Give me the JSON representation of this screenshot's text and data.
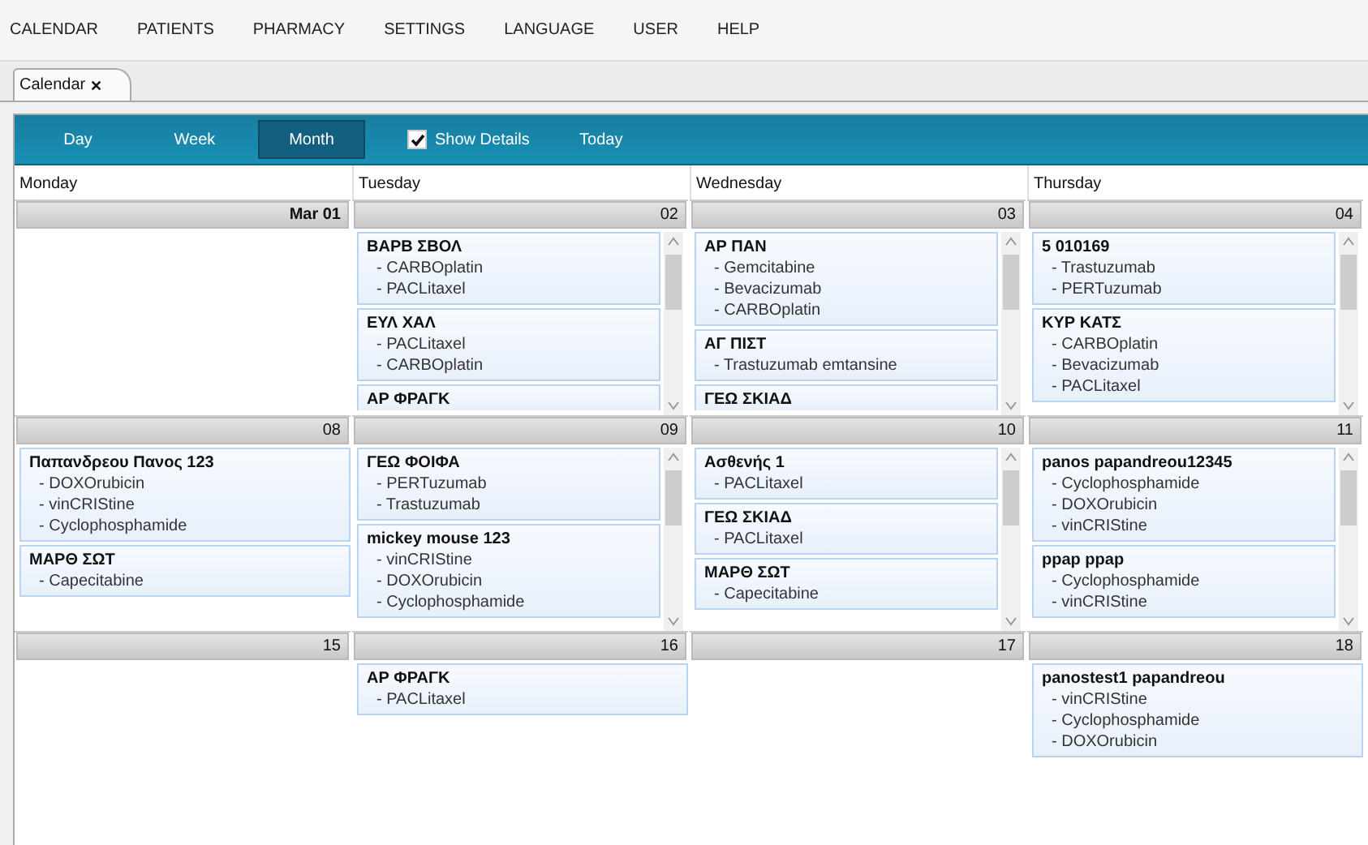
{
  "menu": [
    "CALENDAR",
    "PATIENTS",
    "PHARMACY",
    "SETTINGS",
    "LANGUAGE",
    "USER",
    "HELP"
  ],
  "tabs": [
    {
      "label": "Calendar",
      "close": "✕",
      "selected": true
    }
  ],
  "toolbar": {
    "views": [
      {
        "label": "Day",
        "selected": false
      },
      {
        "label": "Week",
        "selected": false
      },
      {
        "label": "Month",
        "selected": true
      }
    ],
    "show_details": {
      "label": "Show Details",
      "checked": true
    },
    "today": "Today"
  },
  "day_names": [
    "Monday",
    "Tuesday",
    "Wednesday",
    "Thursday"
  ],
  "weeks": [
    {
      "days": [
        {
          "date": "Mar 01"
        },
        {
          "date": "02",
          "appointments": [
            {
              "patient": "ΒΑΡΒ ΣΒΟΛ",
              "drugs": [
                "- CARBOplatin",
                "- PACLitaxel"
              ]
            },
            {
              "patient": "ΕΥΛ ΧΑΛ",
              "drugs": [
                "- PACLitaxel",
                "- CARBOplatin"
              ]
            },
            {
              "patient": "ΑΡ ΦΡΑΓΚ"
            }
          ]
        },
        {
          "date": "03",
          "appointments": [
            {
              "patient": "ΑΡ ΠΑΝ",
              "drugs": [
                "- Gemcitabine",
                "- Bevacizumab",
                "- CARBOplatin"
              ]
            },
            {
              "patient": "ΑΓ ΠΙΣΤ",
              "drugs": [
                "- Trastuzumab emtansine"
              ]
            },
            {
              "patient": "ΓΕΩ ΣΚΙΑΔ"
            }
          ]
        },
        {
          "date": "04",
          "appointments": [
            {
              "patient": "5 010169",
              "drugs": [
                "- Trastuzumab",
                "- PERTuzumab"
              ]
            },
            {
              "patient": "ΚΥΡ ΚΑΤΣ",
              "drugs": [
                "- CARBOplatin",
                "- Bevacizumab",
                "- PACLitaxel"
              ]
            }
          ]
        }
      ]
    },
    {
      "days": [
        {
          "date": "08",
          "appointments": [
            {
              "patient": "Παπανδρεου Πανος 123",
              "drugs": [
                "- DOXOrubicin",
                "- vinCRIStine",
                "- Cyclophosphamide"
              ]
            },
            {
              "patient": "ΜΑΡΘ ΣΩΤ",
              "drugs": [
                "- Capecitabine"
              ]
            }
          ]
        },
        {
          "date": "09",
          "appointments": [
            {
              "patient": "ΓΕΩ ΦΟΙΦΑ",
              "drugs": [
                "- PERTuzumab",
                "- Trastuzumab"
              ]
            },
            {
              "patient": "mickey mouse 123",
              "drugs": [
                "- vinCRIStine",
                "- DOXOrubicin",
                "- Cyclophosphamide"
              ]
            }
          ]
        },
        {
          "date": "10",
          "appointments": [
            {
              "patient": "Ασθενής  1",
              "drugs": [
                "- PACLitaxel"
              ]
            },
            {
              "patient": "ΓΕΩ ΣΚΙΑΔ",
              "drugs": [
                "- PACLitaxel"
              ]
            },
            {
              "patient": "ΜΑΡΘ ΣΩΤ",
              "drugs": [
                "- Capecitabine"
              ]
            }
          ]
        },
        {
          "date": "11",
          "appointments": [
            {
              "patient": "panos papandreou12345",
              "drugs": [
                "- Cyclophosphamide",
                "- DOXOrubicin",
                "- vinCRIStine"
              ]
            },
            {
              "patient": "ppap ppap",
              "drugs": [
                "- Cyclophosphamide",
                "- vinCRIStine"
              ]
            }
          ]
        }
      ]
    },
    {
      "days": [
        {
          "date": "15"
        },
        {
          "date": "16",
          "appointments": [
            {
              "patient": "ΑΡ ΦΡΑΓΚ",
              "drugs": [
                "- PACLitaxel"
              ]
            }
          ]
        },
        {
          "date": "17"
        },
        {
          "date": "18",
          "appointments": [
            {
              "patient": "panostest1 papandreou",
              "drugs": [
                "- vinCRIStine",
                "- Cyclophosphamide",
                "- DOXOrubicin"
              ]
            }
          ]
        }
      ]
    }
  ]
}
